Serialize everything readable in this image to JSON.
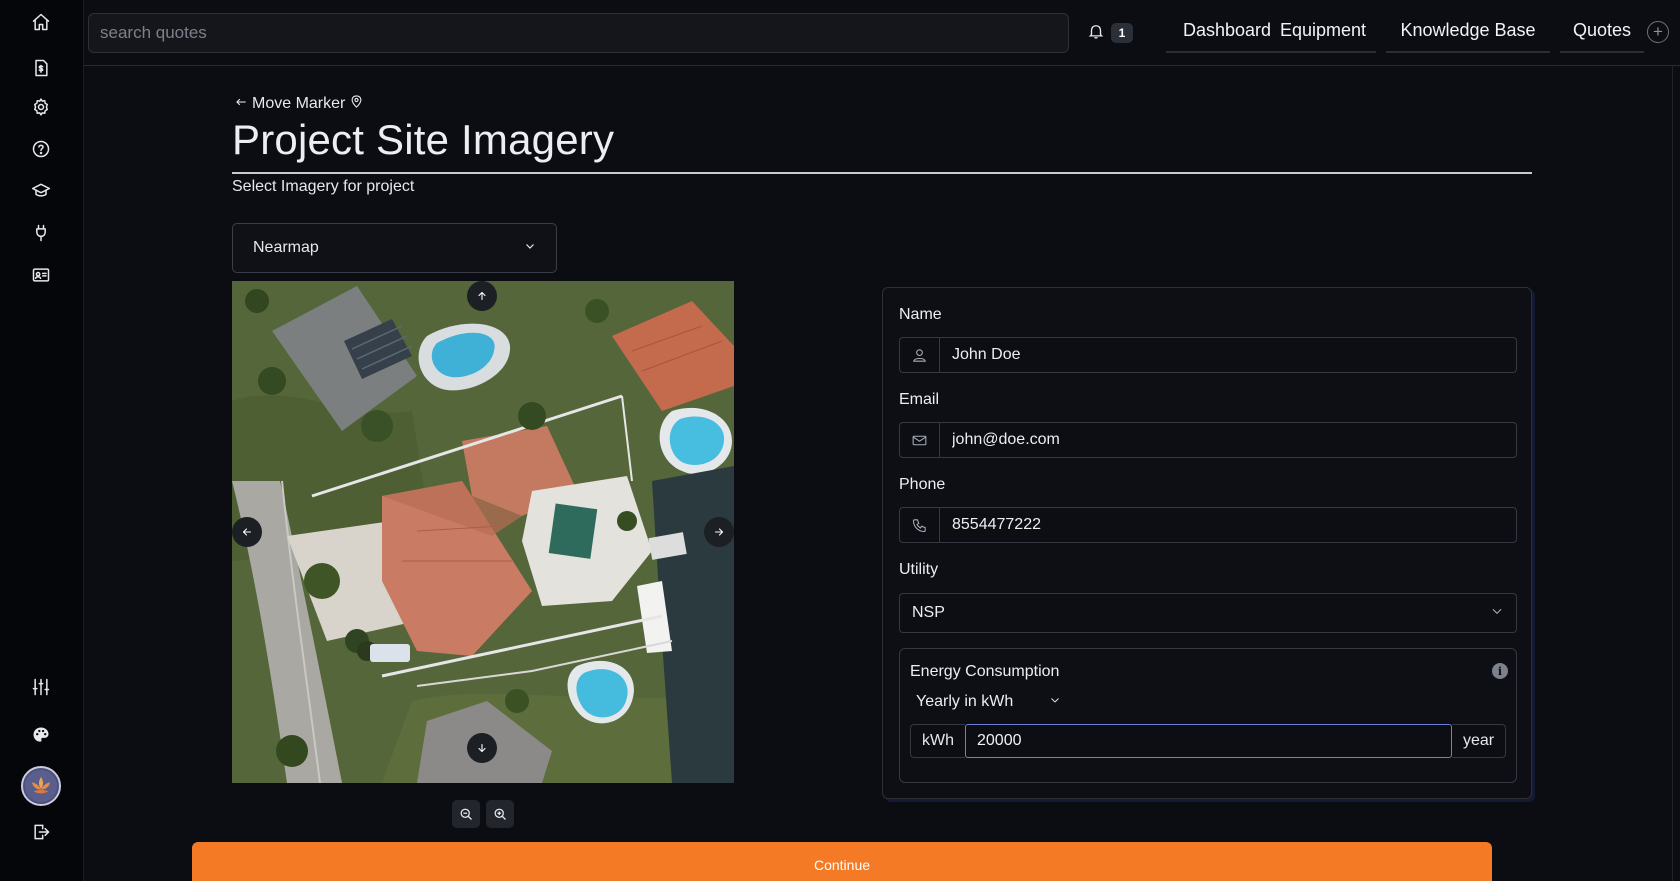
{
  "sidebar": {
    "icons": [
      "home-icon",
      "invoice-icon",
      "settings-icon",
      "help-icon",
      "graduation-cap-icon",
      "plug-icon",
      "id-card-icon",
      "sliders-icon",
      "palette-icon",
      "logout-icon"
    ]
  },
  "topbar": {
    "search_placeholder": "search quotes",
    "notification_count": "1",
    "nav": [
      "Dashboard",
      "Equipment",
      "Knowledge Base",
      "Quotes"
    ]
  },
  "header": {
    "back_label": "Move Marker",
    "title": "Project Site Imagery",
    "subtitle": "Select Imagery for project"
  },
  "imagery": {
    "source_selected": "Nearmap"
  },
  "form": {
    "name_label": "Name",
    "name_value": "John Doe",
    "email_label": "Email",
    "email_value": "john@doe.com",
    "phone_label": "Phone",
    "phone_value": "8554477222",
    "utility_label": "Utility",
    "utility_value": "NSP",
    "energy": {
      "title": "Energy Consumption",
      "period": "Yearly in kWh",
      "unit_prefix": "kWh",
      "value": "20000",
      "unit_suffix": "year"
    }
  },
  "actions": {
    "continue_label": "Continue"
  },
  "colors": {
    "accent": "#f47a26",
    "background": "#0b0d12",
    "sidebar": "#05060a",
    "focus": "#6b7fd6"
  }
}
